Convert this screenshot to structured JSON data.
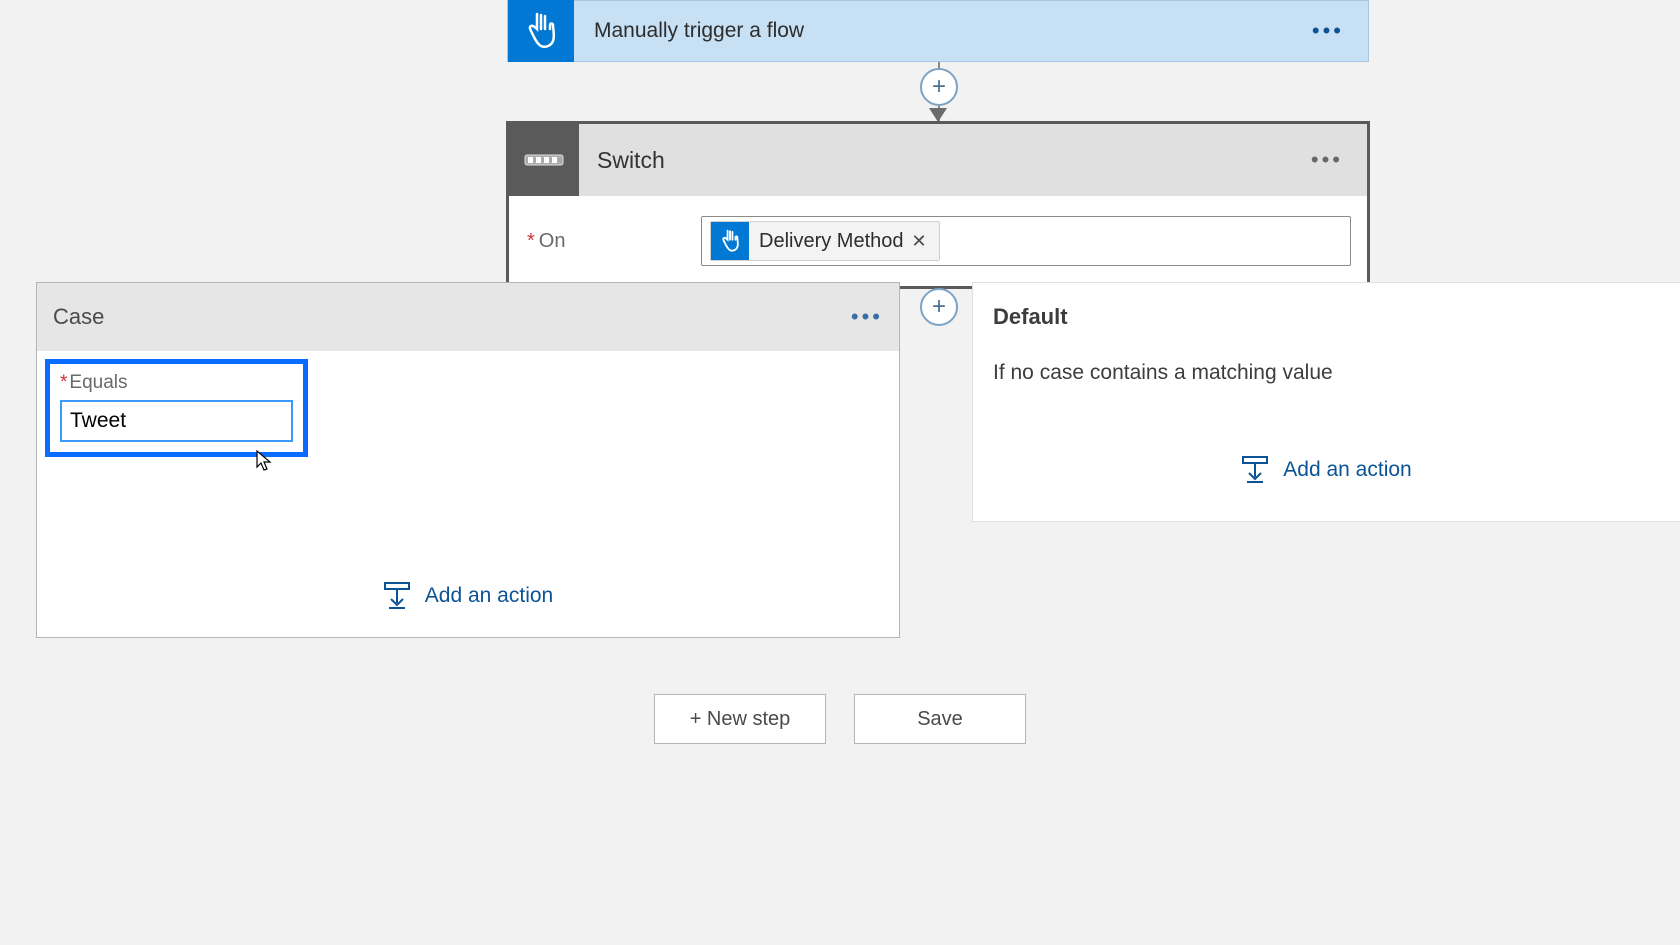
{
  "trigger": {
    "title": "Manually trigger a flow"
  },
  "switch": {
    "title": "Switch",
    "on_label": "On",
    "token": "Delivery Method"
  },
  "case": {
    "title": "Case",
    "equals_label": "Equals",
    "equals_value": "Tweet",
    "add_action": "Add an action"
  },
  "default_branch": {
    "title": "Default",
    "desc": "If no case contains a matching value",
    "add_action": "Add an action"
  },
  "buttons": {
    "new_step": "+ New step",
    "save": "Save"
  }
}
